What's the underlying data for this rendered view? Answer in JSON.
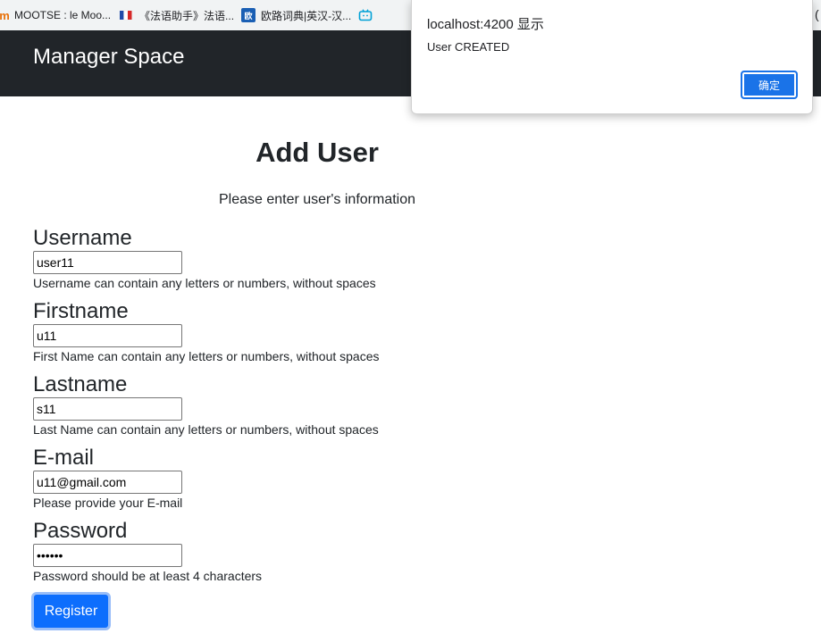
{
  "bookmarks": [
    {
      "label": "MOOTSE : le Moo...",
      "icon": "mootse-icon",
      "glyph": "m"
    },
    {
      "label": "《法语助手》法语...",
      "icon": "french-flag-icon",
      "glyph": ""
    },
    {
      "label": "欧路词典|英汉-汉...",
      "icon": "eudic-icon",
      "glyph": "欧"
    },
    {
      "label": "",
      "icon": "bilibili-icon",
      "glyph": "☐"
    }
  ],
  "navbar": {
    "brand": "Manager Space"
  },
  "page": {
    "title": "Add User",
    "subtitle": "Please enter user's information"
  },
  "form": {
    "username": {
      "label": "Username",
      "value": "user11",
      "help": "Username can contain any letters or numbers, without spaces"
    },
    "firstname": {
      "label": "Firstname",
      "value": "u11",
      "help": "First Name can contain any letters or numbers, without spaces"
    },
    "lastname": {
      "label": "Lastname",
      "value": "s11",
      "help": "Last Name can contain any letters or numbers, without spaces"
    },
    "email": {
      "label": "E-mail",
      "value": "u11@gmail.com",
      "help": "Please provide your E-mail"
    },
    "password": {
      "label": "Password",
      "value": "••••••",
      "help": "Password should be at least 4 characters"
    },
    "submit_label": "Register"
  },
  "dialog": {
    "title": "localhost:4200 显示",
    "message": "User CREATED",
    "ok_label": "确定"
  }
}
